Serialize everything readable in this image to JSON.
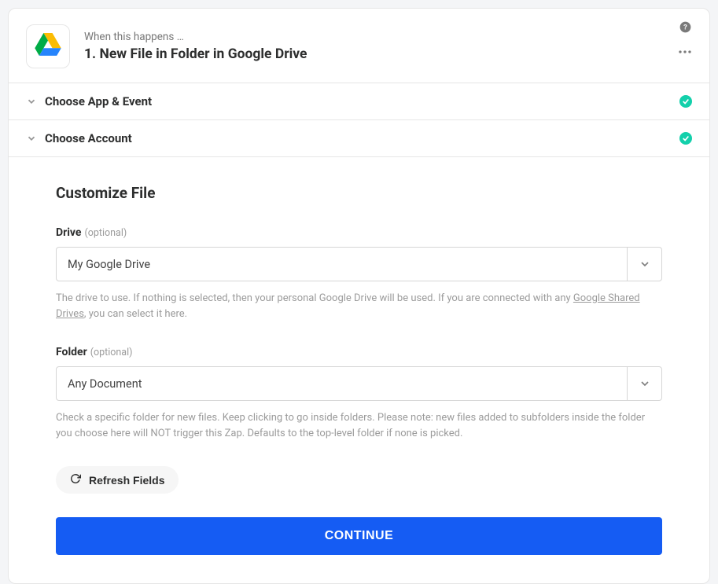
{
  "header": {
    "subtitle": "When this happens …",
    "title": "1. New File in Folder in Google Drive",
    "app_icon": "google-drive-icon"
  },
  "sections": {
    "app_event_label": "Choose App & Event",
    "account_label": "Choose Account"
  },
  "content": {
    "title": "Customize File",
    "drive": {
      "label": "Drive",
      "optional": "(optional)",
      "value": "My Google Drive",
      "help_text_pre": "The drive to use. If nothing is selected, then your personal Google Drive will be used. If you are connected with any ",
      "help_link": "Google Shared Drives",
      "help_text_post": ", you can select it here."
    },
    "folder": {
      "label": "Folder",
      "optional": "(optional)",
      "value": "Any Document",
      "help_text": "Check a specific folder for new files. Keep clicking to go inside folders. Please note: new files added to subfolders inside the folder you choose here will NOT trigger this Zap. Defaults to the top-level folder if none is picked."
    },
    "refresh_label": "Refresh Fields",
    "continue_label": "CONTINUE"
  }
}
